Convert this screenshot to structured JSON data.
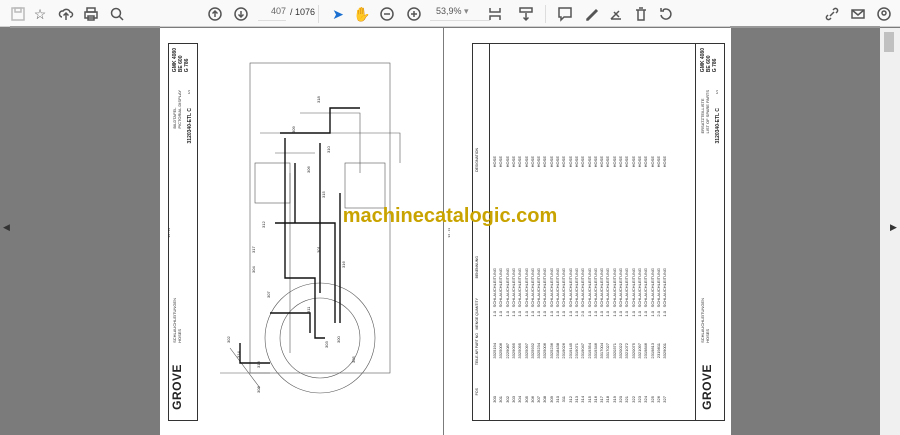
{
  "toolbar": {
    "left_icons": [
      "save-icon",
      "bookmark-star-icon",
      "upload-cloud-icon",
      "print-icon",
      "find-icon"
    ],
    "page_current": "407",
    "page_total": "/ 1076",
    "zoom_value": "53,9%",
    "right_icons": [
      "link-share-icon",
      "email-icon",
      "account-icon"
    ]
  },
  "watermark": "machinecatalogic.com",
  "left_page": {
    "title_de": "BILDTAFEL",
    "title_en": "PICTORIAL DISPLAY",
    "doc_no": "3120340-ETL C",
    "sheet": "1/1",
    "model": [
      "GMK 4080",
      "BE 600",
      "G 786"
    ],
    "section_de": "SCHLAUCHLEITUNGEN",
    "section_en": "HOSES",
    "logo": "GROVE",
    "page_ref": "94 - 13",
    "callouts": [
      "300",
      "301",
      "302",
      "303",
      "304",
      "305",
      "306",
      "307",
      "308",
      "309",
      "310",
      "311",
      "312",
      "313",
      "314",
      "315",
      "316",
      "317",
      "318"
    ]
  },
  "right_page": {
    "title_de": "ERSATZTEILLISTE",
    "title_en": "LIST OF SPARE PARTS",
    "doc_no": "3120340-ETL C",
    "sheet": "1/1",
    "model": [
      "GMK 4080",
      "BE 600",
      "G 786"
    ],
    "section_de": "SCHLAUCHLEITUNGEN",
    "section_en": "HOSES",
    "logo": "GROVE",
    "page_ref": "94 - 13",
    "headers": {
      "pos": "POS",
      "part": "TEILE-NR PART NO",
      "qty": "MENGE QUANTITY",
      "de": "BENENNUNG",
      "en": "DESIGNATION"
    },
    "rows": [
      [
        "300",
        "3325194",
        "1.0",
        "SCHLAUCHLEITUNG",
        "HOSE"
      ],
      [
        "301",
        "3325006",
        "1.0",
        "SCHLAUCHLEITUNG",
        "HOSE"
      ],
      [
        "302",
        "2229087",
        "1.0",
        "SCHLAUCHLEITUNG",
        "HOSE"
      ],
      [
        "303",
        "3329095",
        "1.0",
        "SCHLAUCHLEITUNG",
        "HOSE"
      ],
      [
        "304",
        "3325095",
        "1.0",
        "SCHLAUCHLEITUNG",
        "HOSE"
      ],
      [
        "305",
        "3325097",
        "1.0",
        "SCHLAUCHLEITUNG",
        "HOSE"
      ],
      [
        "306",
        "3325932",
        "1.0",
        "SCHLAUCHLEITUNG",
        "HOSE"
      ],
      [
        "307",
        "3325234",
        "1.0",
        "SCHLAUCHLEITUNG",
        "HOSE"
      ],
      [
        "308",
        "3325006",
        "1.0",
        "SCHLAUCHLEITUNG",
        "HOSE"
      ],
      [
        "309",
        "3325236",
        "1.0",
        "SCHLAUCHLEITUNG",
        "HOSE"
      ],
      [
        "310",
        "2318438",
        "1.0",
        "SCHLAUCHLEITUNG",
        "HOSE"
      ],
      [
        "311",
        "2319026",
        "1.0",
        "SCHLAUCHLEITUNG",
        "HOSE"
      ],
      [
        "312",
        "2319145",
        "1.0",
        "SCHLAUCHLEITUNG",
        "HOSE"
      ],
      [
        "313",
        "2319071",
        "1.0",
        "SCHLAUCHLEITUNG",
        "HOSE"
      ],
      [
        "314",
        "2319047",
        "2.0",
        "SCHLAUCHLEITUNG",
        "HOSE"
      ],
      [
        "315",
        "2319354",
        "1.0",
        "SCHLAUCHLEITUNG",
        "HOSE"
      ],
      [
        "316",
        "3319346",
        "1.0",
        "SCHLAUCHLEITUNG",
        "HOSE"
      ],
      [
        "317",
        "3317004",
        "1.0",
        "SCHLAUCHLEITUNG",
        "HOSE"
      ],
      [
        "318",
        "3317027",
        "1.0",
        "SCHLAUCHLEITUNG",
        "HOSE"
      ],
      [
        "319",
        "3320371",
        "1.0",
        "SCHLAUCHLEITUNG",
        "HOSE"
      ],
      [
        "320",
        "3320022",
        "1.0",
        "SCHLAUCHLEITUNG",
        "HOSE"
      ],
      [
        "321",
        "3321072",
        "1.0",
        "SCHLAUCHLEITUNG",
        "HOSE"
      ],
      [
        "322",
        "3320075",
        "1.0",
        "SCHLAUCHLEITUNG",
        "HOSE"
      ],
      [
        "323",
        "3321097",
        "1.0",
        "SCHLAUCHLEITUNG",
        "HOSE"
      ],
      [
        "324",
        "2319846",
        "1.0",
        "SCHLAUCHLEITUNG",
        "HOSE"
      ],
      [
        "325",
        "2319813",
        "1.0",
        "SCHLAUCHLEITUNG",
        "HOSE"
      ],
      [
        "326",
        "2319811",
        "2.0",
        "SCHLAUCHLEITUNG",
        "HOSE"
      ],
      [
        "327",
        "3329001",
        "1.0",
        "SCHLAUCHLEITUNG",
        "HOSE"
      ]
    ]
  }
}
